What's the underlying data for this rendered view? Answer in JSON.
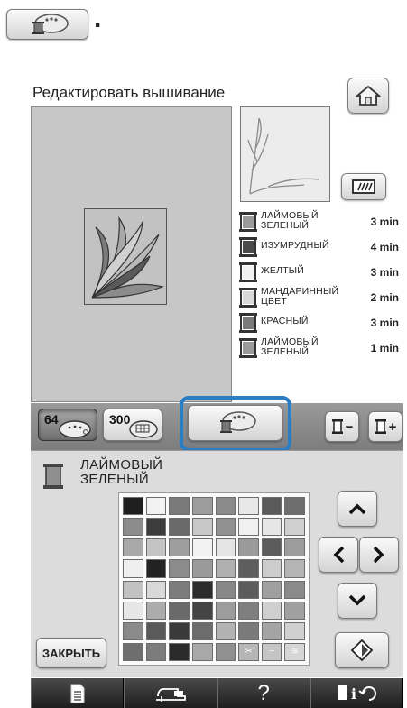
{
  "instruction": {
    "period": "."
  },
  "header": {
    "title": "Редактировать вышивание"
  },
  "threads": [
    {
      "name": "ЛАЙМОВЫЙ ЗЕЛЕНЫЙ",
      "time": "3 min",
      "color": "#9a9a9a"
    },
    {
      "name": "ИЗУМРУДНЫЙ",
      "time": "4 min",
      "color": "#4a4a4a"
    },
    {
      "name": "ЖЕЛТЫЙ",
      "time": "3 min",
      "color": "#f2f2f2"
    },
    {
      "name": "МАНДАРИННЫЙ ЦВЕТ",
      "time": "2 min",
      "color": "#d8d8d8"
    },
    {
      "name": "КРАСНЫЙ",
      "time": "3 min",
      "color": "#7a7a7a"
    },
    {
      "name": "ЛАЙМОВЫЙ ЗЕЛЕНЫЙ",
      "time": "1 min",
      "color": "#9a9a9a"
    }
  ],
  "tabs": {
    "tab64_label": "64",
    "tab300_label": "300"
  },
  "spool_buttons": {
    "minus": "−",
    "plus": "+"
  },
  "palette": {
    "selected_name": "ЛАЙМОВЫЙ ЗЕЛЕНЫЙ",
    "selected_color": "#8f8f8f",
    "close_label": "ЗАКРЫТЬ",
    "swatches": [
      "#1e1e1e",
      "#f2f2f2",
      "#7a7a7a",
      "#9c9c9c",
      "#8a8a8a",
      "#e8e8e8",
      "#5a5a5a",
      "#6e6e6e",
      "#8c8c8c",
      "#3c3c3c",
      "#6a6a6a",
      "#c8c8c8",
      "#909090",
      "#f0f0f0",
      "#e6e6e6",
      "#cfcfcf",
      "#a8a8a8",
      "#c4c4c4",
      "#9e9e9e",
      "#f2f2f2",
      "#e4e4e4",
      "#9a9a9a",
      "#5c5c5c",
      "#9c9c9c",
      "#efefef",
      "#222222",
      "#8c8c8c",
      "#9a9a9a",
      "#b0b0b0",
      "#5e5e5e",
      "#cccccc",
      "#b4b4b4",
      "#c2c2c2",
      "#d8d8d8",
      "#7c7c7c",
      "#2c2c2c",
      "#888888",
      "#5c5c5c",
      "#a0a0a0",
      "#8a8a8a",
      "#e6e6e6",
      "#acacac",
      "#6a6a6a",
      "#444444",
      "#9c9c9c",
      "#7e7e7e",
      "#cfcfcf",
      "#a0a0a0",
      "#8a8a8a",
      "#5a5a5a",
      "#3a3a3a",
      "#6c6c6c",
      "#b2b2b2",
      "#7a7a7a",
      "#a4a4a4",
      "#d0d0d0",
      "#6e6e6e",
      "#7c7c7c",
      "#2a2a2a",
      "#a8a8a8",
      "#909090",
      "#b6b6b6",
      "#c4c4c4",
      "#d6d6d6"
    ]
  },
  "bottombar": {
    "help_label": "?"
  }
}
